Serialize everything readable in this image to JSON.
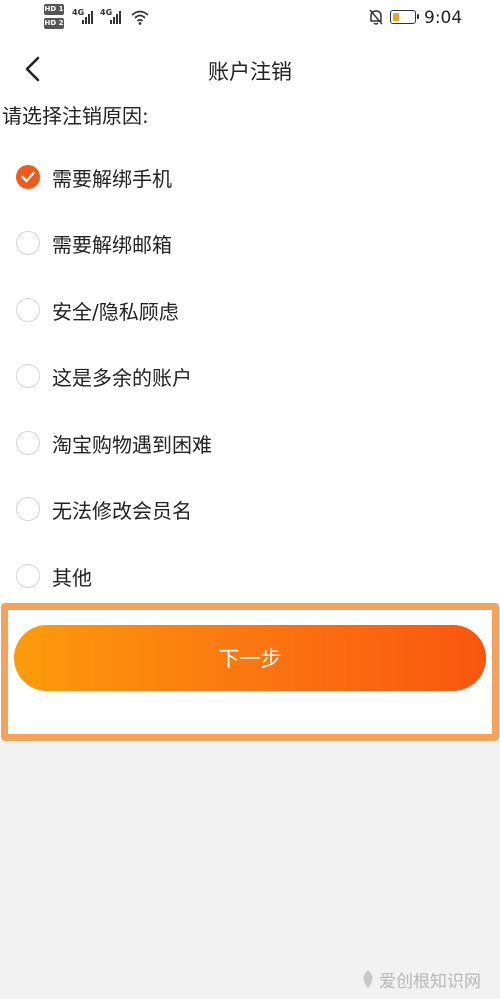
{
  "status_bar": {
    "hd_badges": [
      "HD 1",
      "HD 2"
    ],
    "network_labels": [
      "4G",
      "4G"
    ],
    "battery_level": 0.3,
    "time": "9:04"
  },
  "header": {
    "title": "账户注销",
    "back_icon": "chevron-left-icon"
  },
  "prompt": "请选择注销原因:",
  "reasons": [
    {
      "label": "需要解绑手机",
      "checked": true
    },
    {
      "label": "需要解绑邮箱",
      "checked": false
    },
    {
      "label": "安全/隐私顾虑",
      "checked": false
    },
    {
      "label": "这是多余的账户",
      "checked": false
    },
    {
      "label": "淘宝购物遇到困难",
      "checked": false
    },
    {
      "label": "无法修改会员名",
      "checked": false
    },
    {
      "label": "其他",
      "checked": false
    }
  ],
  "next_button": {
    "label": "下一步"
  },
  "watermark": {
    "text": "爱创根知识网"
  },
  "colors": {
    "accent": "#f05a1a",
    "button_gradient_start": "#fd9b0a",
    "button_gradient_end": "#f9560f",
    "highlight_border": "#f7a25a",
    "background": "#f2f2f2"
  }
}
